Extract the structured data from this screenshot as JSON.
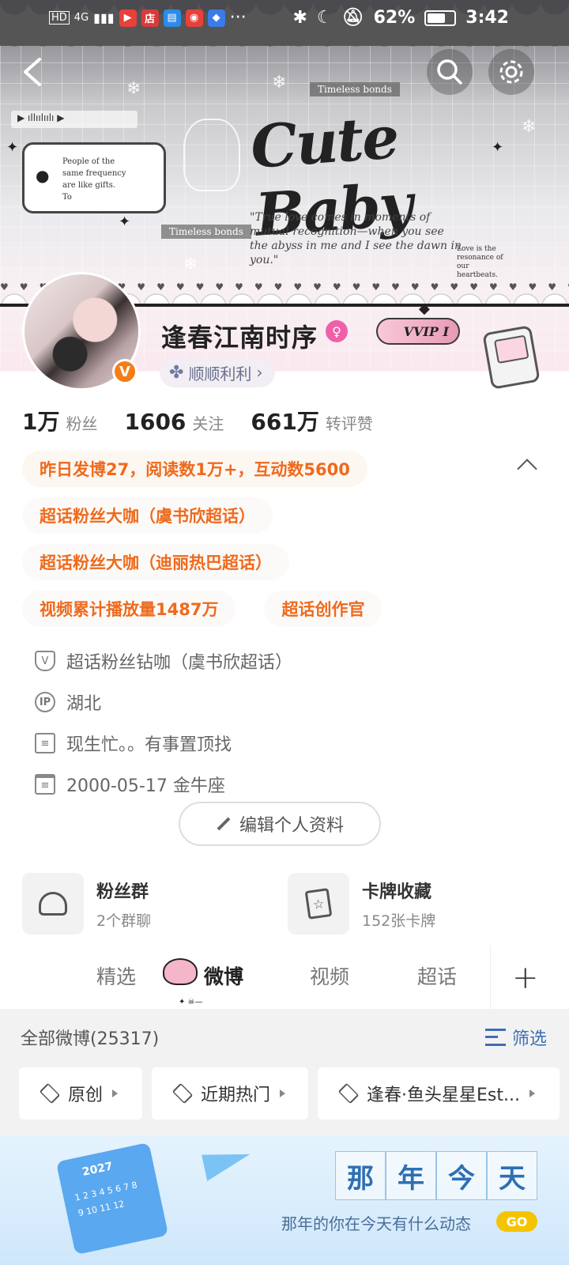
{
  "status_bar": {
    "left_labels": [
      "HD",
      "4G"
    ],
    "apps": [
      {
        "name": "video-app",
        "glyph": "▶",
        "color": "#e8403a"
      },
      {
        "name": "shop-app",
        "glyph": "店",
        "color": "#d93b3b"
      },
      {
        "name": "reader-app",
        "glyph": "▤",
        "color": "#2c8be8"
      },
      {
        "name": "weibo-app",
        "glyph": "◉",
        "color": "#e8403a"
      },
      {
        "name": "tool-app",
        "glyph": "◆",
        "color": "#3a7be8"
      }
    ],
    "more": "···",
    "battery": "62%",
    "time": "3:42"
  },
  "banner": {
    "title_art": "Cute Baby",
    "note_card": [
      "People of the",
      "same frequency",
      "are like gifts.",
      "To"
    ],
    "quote": "\"True love comes in moments of mutual recognition—when you see the abyss in me and I see the dawn in you.\"",
    "tag_1": "Timeless bonds",
    "tag_2": "Timeless bonds",
    "small_note": "Love is the resonance of our heartbeats."
  },
  "profile": {
    "username": "逢春江南时序",
    "vip_label": "VVIP I",
    "badge_letter": "V",
    "shunshun_label": "顺顺利利",
    "stats": [
      {
        "num": "1万",
        "label": "粉丝"
      },
      {
        "num": "1606",
        "label": "关注"
      },
      {
        "num": "661万",
        "label": "转评赞"
      }
    ]
  },
  "badges": {
    "row1": "昨日发博27，阅读数1万+，互动数5600",
    "row2": "超话粉丝大咖（虞书欣超话）",
    "row3": "超话粉丝大咖（迪丽热巴超话）",
    "row4a": "视频累计播放量1487万",
    "row4b": "超话创作官"
  },
  "info": {
    "supertopic": "超话粉丝钻咖（虞书欣超话）",
    "ip_label": "IP",
    "location": "湖北",
    "bio": "现生忙。。有事置顶找",
    "birthday": "2000-05-17 金牛座"
  },
  "edit_button": "编辑个人资料",
  "cards": [
    {
      "title": "粉丝群",
      "sub": "2个群聊"
    },
    {
      "title": "卡牌收藏",
      "sub": "152张卡牌"
    }
  ],
  "tabs": [
    "精选",
    "微博",
    "视频",
    "超话"
  ],
  "feed": {
    "count_label": "全部微博(25317)",
    "filter_label": "筛选",
    "chips": [
      "原创",
      "近期热门",
      "逢春·鱼头星星Est..."
    ]
  },
  "promo": {
    "title_chars": [
      "那",
      "年",
      "今",
      "天"
    ],
    "subtitle": "那年的你在今天有什么动态",
    "go": "GO"
  }
}
